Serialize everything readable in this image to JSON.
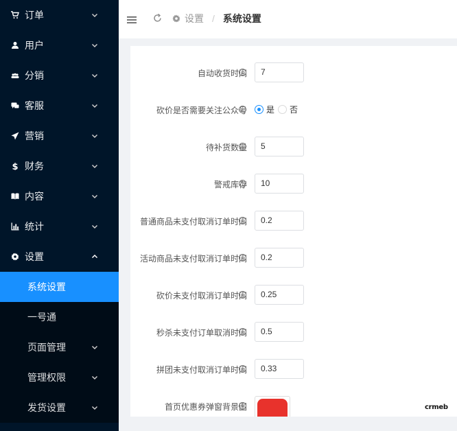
{
  "sidebar": {
    "items": [
      {
        "label": "订单",
        "icon": "cart-icon"
      },
      {
        "label": "用户",
        "icon": "user-icon"
      },
      {
        "label": "分销",
        "icon": "group-icon"
      },
      {
        "label": "客服",
        "icon": "chat-icon"
      },
      {
        "label": "营销",
        "icon": "send-icon"
      },
      {
        "label": "财务",
        "icon": "dollar-icon"
      },
      {
        "label": "内容",
        "icon": "book-icon"
      },
      {
        "label": "统计",
        "icon": "bar-chart-icon"
      },
      {
        "label": "设置",
        "icon": "gear-icon"
      }
    ],
    "sub_items": [
      {
        "label": "系统设置",
        "active": true
      },
      {
        "label": "一号通",
        "active": false
      },
      {
        "label": "页面管理",
        "active": false
      },
      {
        "label": "管理权限",
        "active": false
      },
      {
        "label": "发货设置",
        "active": false
      }
    ]
  },
  "header": {
    "breadcrumb_parent": "设置",
    "breadcrumb_sep": "/",
    "breadcrumb_current": "系统设置"
  },
  "form": {
    "auto_receive": {
      "label": "自动收货时间",
      "value": "7"
    },
    "bargain_follow": {
      "label": "砍价是否需要关注公众号",
      "option_yes": "是",
      "option_no": "否",
      "selected": "是"
    },
    "restock": {
      "label": "待补货数量",
      "value": "5"
    },
    "alert_stock": {
      "label": "警戒库存",
      "value": "10"
    },
    "normal_unpaid": {
      "label": "普通商品未支付取消订单时间",
      "value": "0.2"
    },
    "activity_unpaid": {
      "label": "活动商品未支付取消订单时间",
      "value": "0.2"
    },
    "bargain_unpaid": {
      "label": "砍价未支付取消订单时间",
      "value": "0.25"
    },
    "seckill_unpaid": {
      "label": "秒杀未支付订单取消时间",
      "value": "0.5"
    },
    "group_unpaid": {
      "label": "拼团未支付取消订单时间",
      "value": "0.33"
    },
    "coupon_bg": {
      "label": "首页优惠券弹窗背景图"
    }
  },
  "info_glyph": "i",
  "logo_text": "crmeb",
  "colors": {
    "sidebar_bg": "#001529",
    "active": "#1890ff"
  }
}
